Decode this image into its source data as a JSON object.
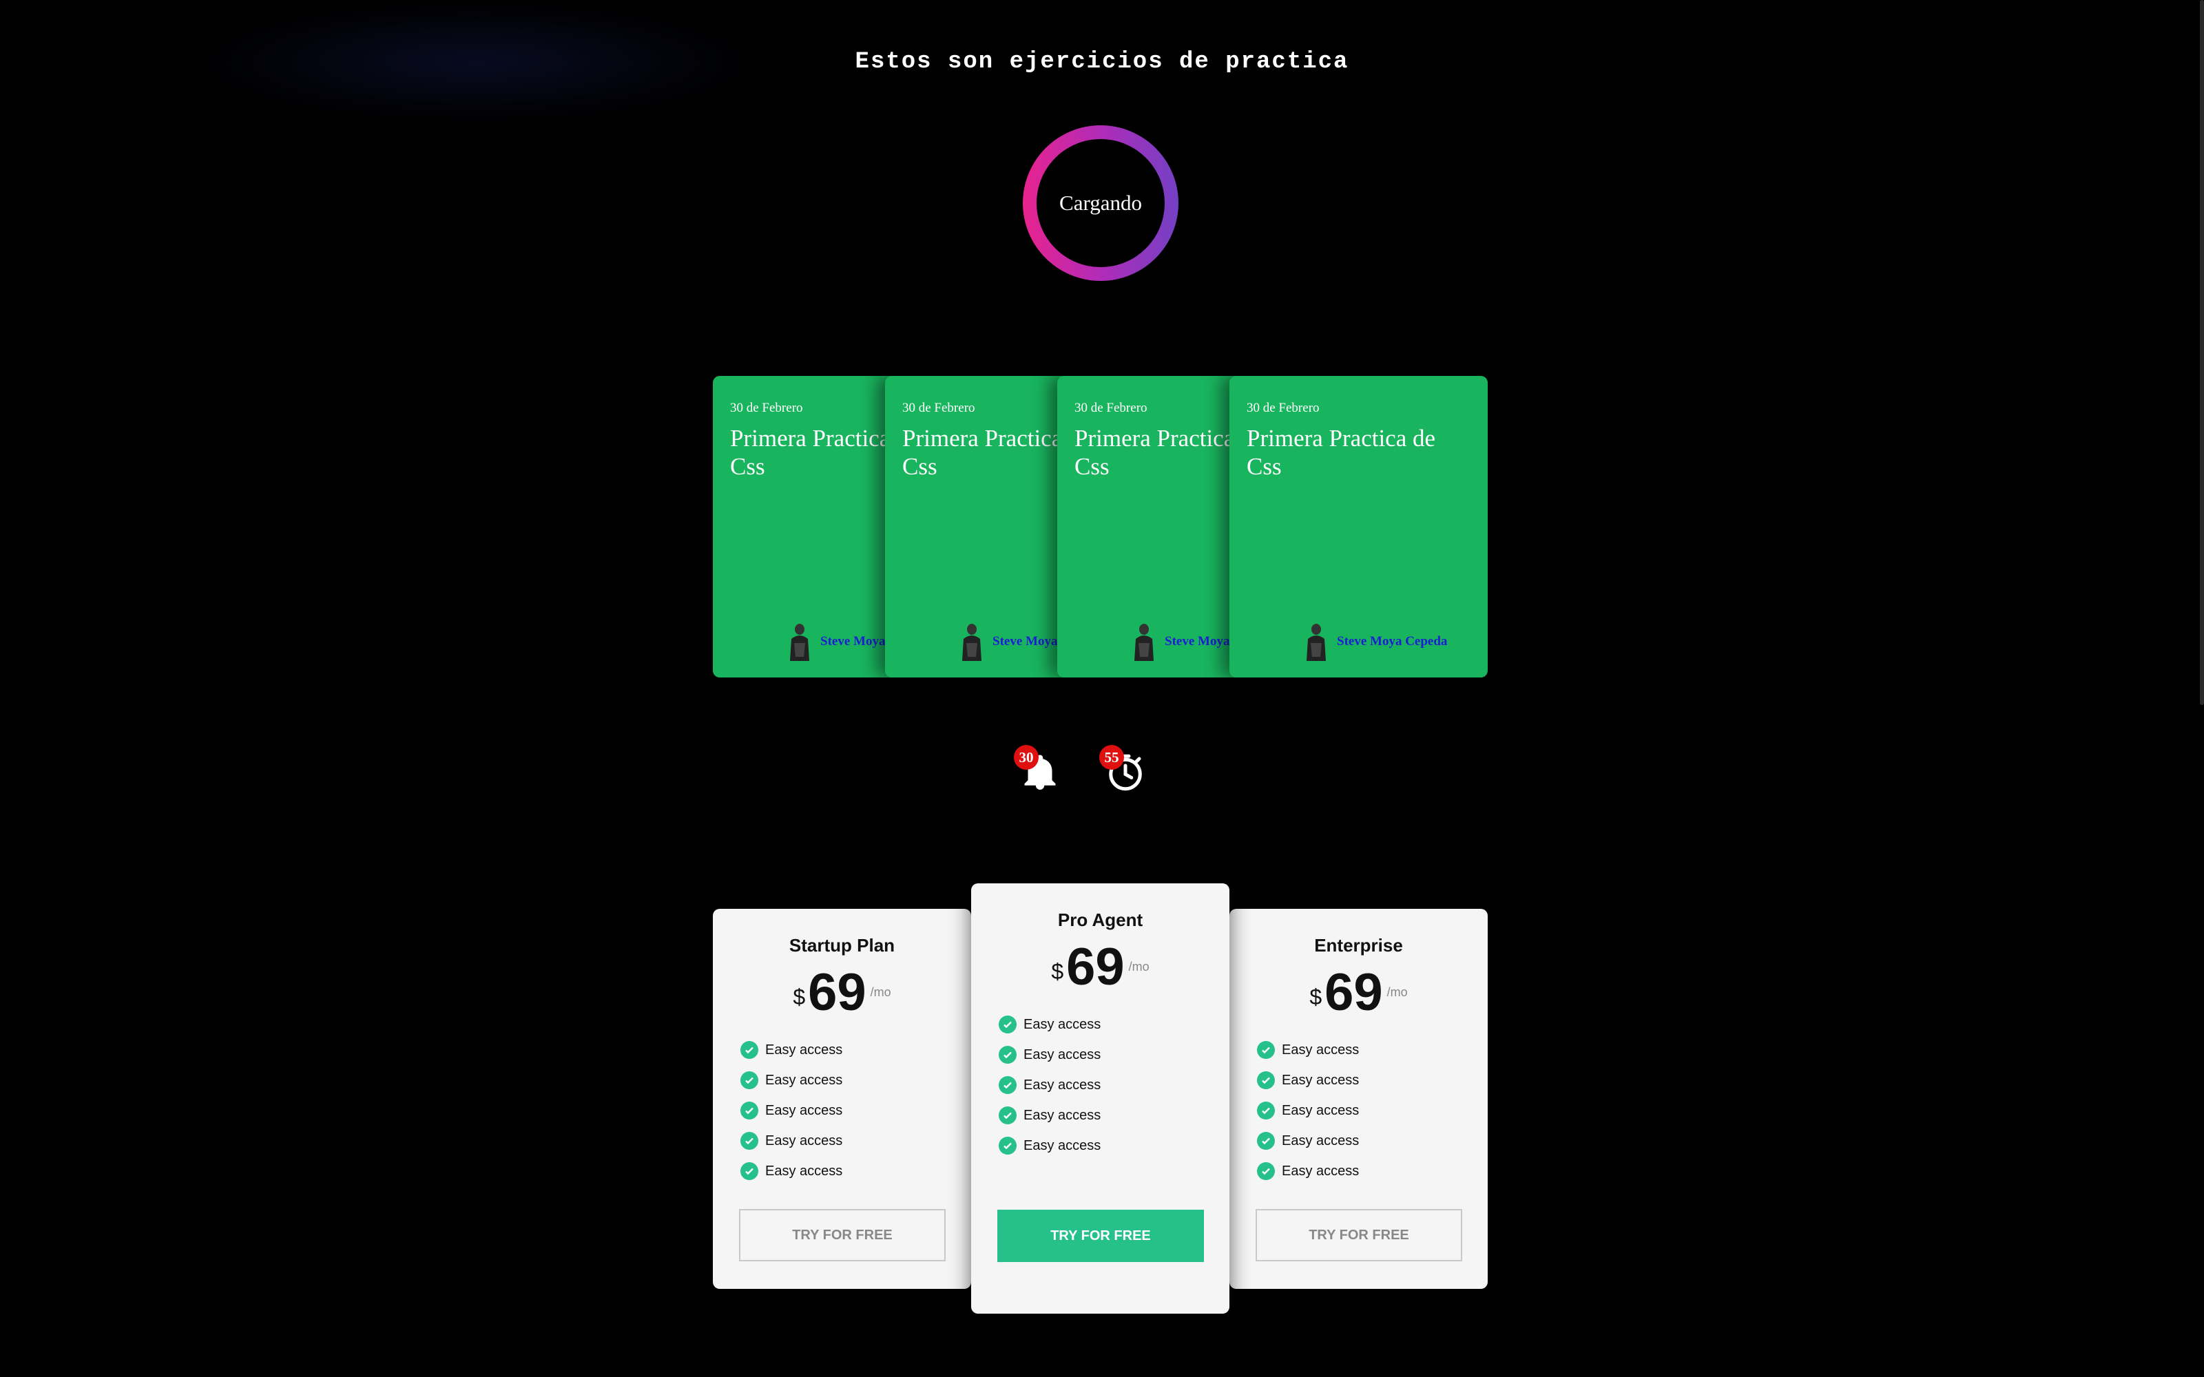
{
  "page": {
    "title": "Estos son ejercicios de practica"
  },
  "loader": {
    "label": "Cargando"
  },
  "cards": [
    {
      "date": "30 de Febrero",
      "title": "Primera Practica de Css",
      "author": "Steve Moya Cepeda"
    },
    {
      "date": "30 de Febrero",
      "title": "Primera Practica de Css",
      "author": "Steve Moya Cepeda"
    },
    {
      "date": "30 de Febrero",
      "title": "Primera Practica de Css",
      "author": "Steve Moya Cepeda"
    },
    {
      "date": "30 de Febrero",
      "title": "Primera Practica de Css",
      "author": "Steve Moya Cepeda"
    }
  ],
  "notifications": {
    "bell": {
      "count": "30",
      "icon": "bell-icon"
    },
    "timer": {
      "count": "55",
      "icon": "stopwatch-icon"
    }
  },
  "plans": [
    {
      "name": "Startup Plan",
      "currency": "$",
      "price": "69",
      "period": "/mo",
      "features": [
        "Easy access",
        "Easy access",
        "Easy access",
        "Easy access",
        "Easy access"
      ],
      "cta": "TRY FOR FREE"
    },
    {
      "name": "Pro Agent",
      "currency": "$",
      "price": "69",
      "period": "/mo",
      "features": [
        "Easy access",
        "Easy access",
        "Easy access",
        "Easy access",
        "Easy access"
      ],
      "cta": "TRY FOR FREE"
    },
    {
      "name": "Enterprise",
      "currency": "$",
      "price": "69",
      "period": "/mo",
      "features": [
        "Easy access",
        "Easy access",
        "Easy access",
        "Easy access",
        "Easy access"
      ],
      "cta": "TRY FOR FREE"
    }
  ],
  "colors": {
    "card": "#19b45e",
    "accent": "#26c08a",
    "badge": "#e01010",
    "author": "#1d1dd6"
  }
}
